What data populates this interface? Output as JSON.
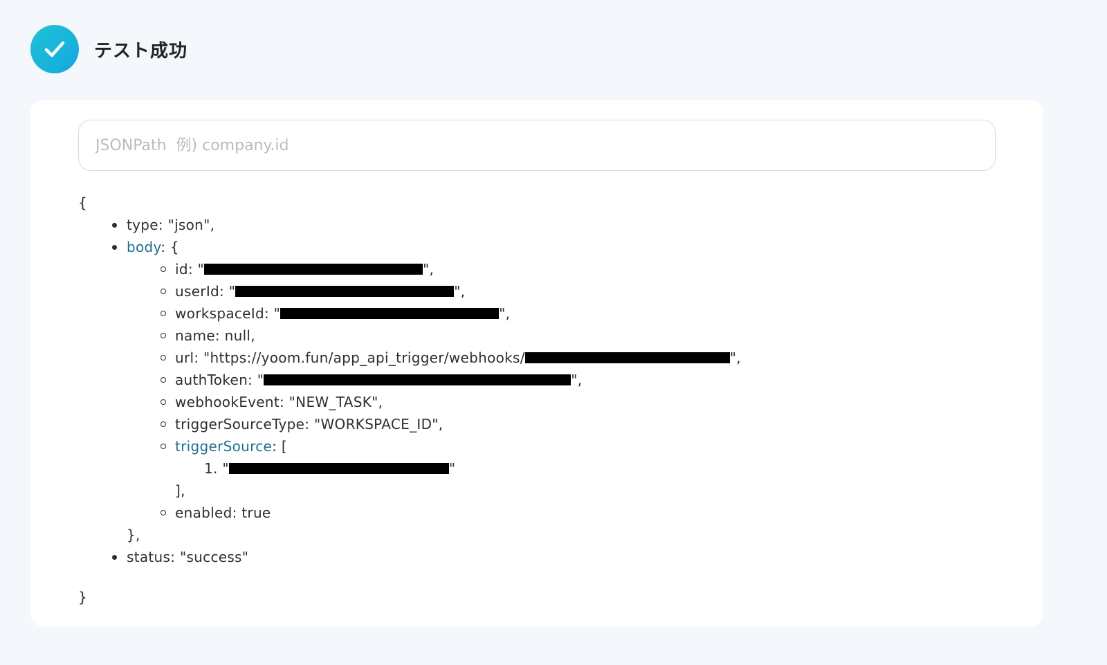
{
  "header": {
    "title": "テスト成功",
    "icon": "check-circle-icon",
    "icon_color": "#14a7e0"
  },
  "search": {
    "placeholder": "JSONPath  例) company.id",
    "value": ""
  },
  "json_tree": {
    "open_brace": "{",
    "close_brace": "}",
    "type_line": "type: \"json\",",
    "body_key": "body",
    "body_open": ": {",
    "id_prefix": "id: \"",
    "id_suffix": "\",",
    "userid_prefix": "userId: \"",
    "userid_suffix": "\",",
    "workspaceid_prefix": "workspaceId: \"",
    "workspaceid_suffix": "\",",
    "name_line": "name: null,",
    "url_prefix": "url: \"https://yoom.fun/app_api_trigger/webhooks/",
    "url_suffix": "\",",
    "authtoken_prefix": "authToken: \"",
    "authtoken_suffix": "\",",
    "webhookevent_line": "webhookEvent: \"NEW_TASK\",",
    "triggersourcetype_line": "triggerSourceType: \"WORKSPACE_ID\",",
    "triggersource_key": "triggerSource",
    "triggersource_open": ": [",
    "item_prefix": "1. \"",
    "item_suffix": "\"",
    "array_close": "],",
    "enabled_line": "enabled: true",
    "body_close": "},",
    "status_line": "status: \"success\""
  },
  "colors": {
    "link_key": "#1f6f8b",
    "background": "#f4f7fb",
    "panel": "#ffffff"
  }
}
